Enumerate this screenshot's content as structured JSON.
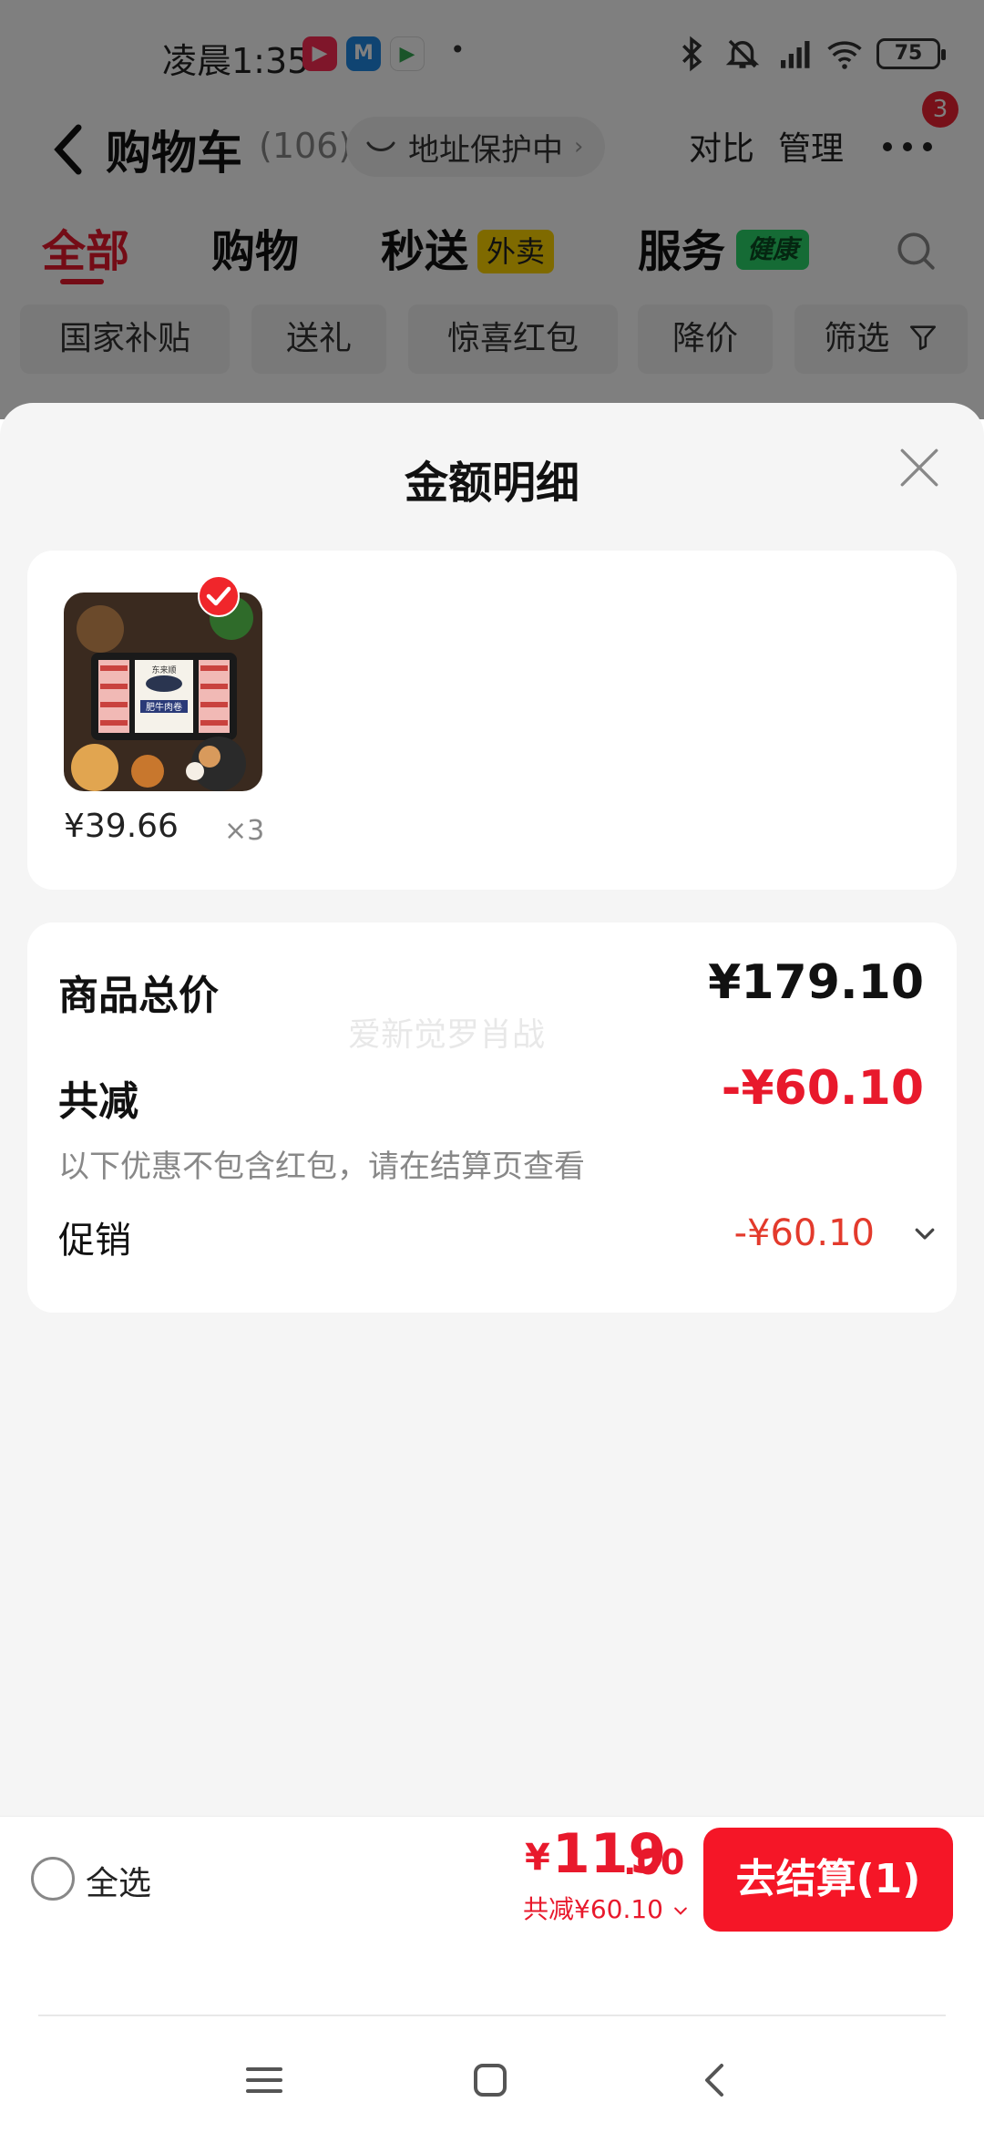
{
  "status_bar": {
    "time": "凌晨1:35",
    "icons": [
      "video-app-icon",
      "m-app-icon",
      "play-app-icon",
      "bluetooth-icon",
      "mute-icon",
      "signal-hd-icon",
      "wifi-icon"
    ],
    "battery": "75"
  },
  "nav": {
    "title": "购物车",
    "count": "(106)",
    "address_protect": "地址保护中",
    "compare": "对比",
    "manage": "管理",
    "notification_count": "3"
  },
  "tabs": [
    {
      "label": "全部",
      "active": true
    },
    {
      "label": "购物",
      "active": false
    },
    {
      "label": "秒送",
      "tag": "外卖",
      "active": false
    },
    {
      "label": "服务",
      "tag": "健康",
      "active": false
    }
  ],
  "filters": [
    "国家补贴",
    "送礼",
    "惊喜红包",
    "降价",
    "筛选"
  ],
  "sheet": {
    "title": "金额明细",
    "product": {
      "image_label": "肥牛肉卷",
      "brand_text": "东来顺",
      "price": "¥39.66",
      "quantity": "×3"
    },
    "detail": {
      "total_label": "商品总价",
      "total_value": "¥179.10",
      "watermark": "爱新觉罗肖战",
      "discount_label": "共减",
      "discount_value": "-¥60.10",
      "hint": "以下优惠不包含红包，请在结算页查看",
      "promo_label": "促销",
      "promo_value": "-¥60.10"
    }
  },
  "checkout": {
    "select_all": "全选",
    "currency": "¥",
    "total_int": "119",
    "total_dec": ".00",
    "discount": "共减¥60.10",
    "button": "去结算(1)"
  },
  "colors": {
    "accent_red": "#e8192c",
    "checkout_button": "#f51627",
    "sheet_background": "#f5f5f5"
  }
}
